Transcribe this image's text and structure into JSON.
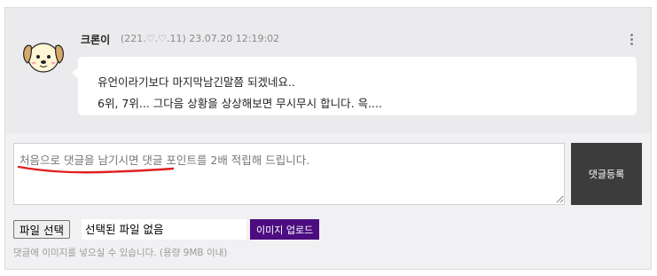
{
  "comment": {
    "author": "크론이",
    "meta": "(221.♡.♡.11) 23.07.20 12:19:02",
    "lines": [
      "유언이라기보다 마지막남긴말쯤 되겠네요..",
      "6위, 7위... 그다음 상황을 상상해보면 무시무시 합니다. 윽...."
    ]
  },
  "reply": {
    "placeholder": "처음으로 댓글을 남기시면 댓글 포인트를 2배 적립해 드립니다.",
    "submit_label": "댓글등록"
  },
  "file": {
    "choose_label": "파일 선택",
    "status": "선택된 파일 없음",
    "upload_label": "이미지 업로드",
    "hint": "댓글에 이미지를 넣으실 수 있습니다. (용량 9MB 이내)"
  },
  "colors": {
    "upload_button": "#4b0d7f",
    "submit_button": "#3c3c3c",
    "annotation_underline": "#e02020"
  }
}
